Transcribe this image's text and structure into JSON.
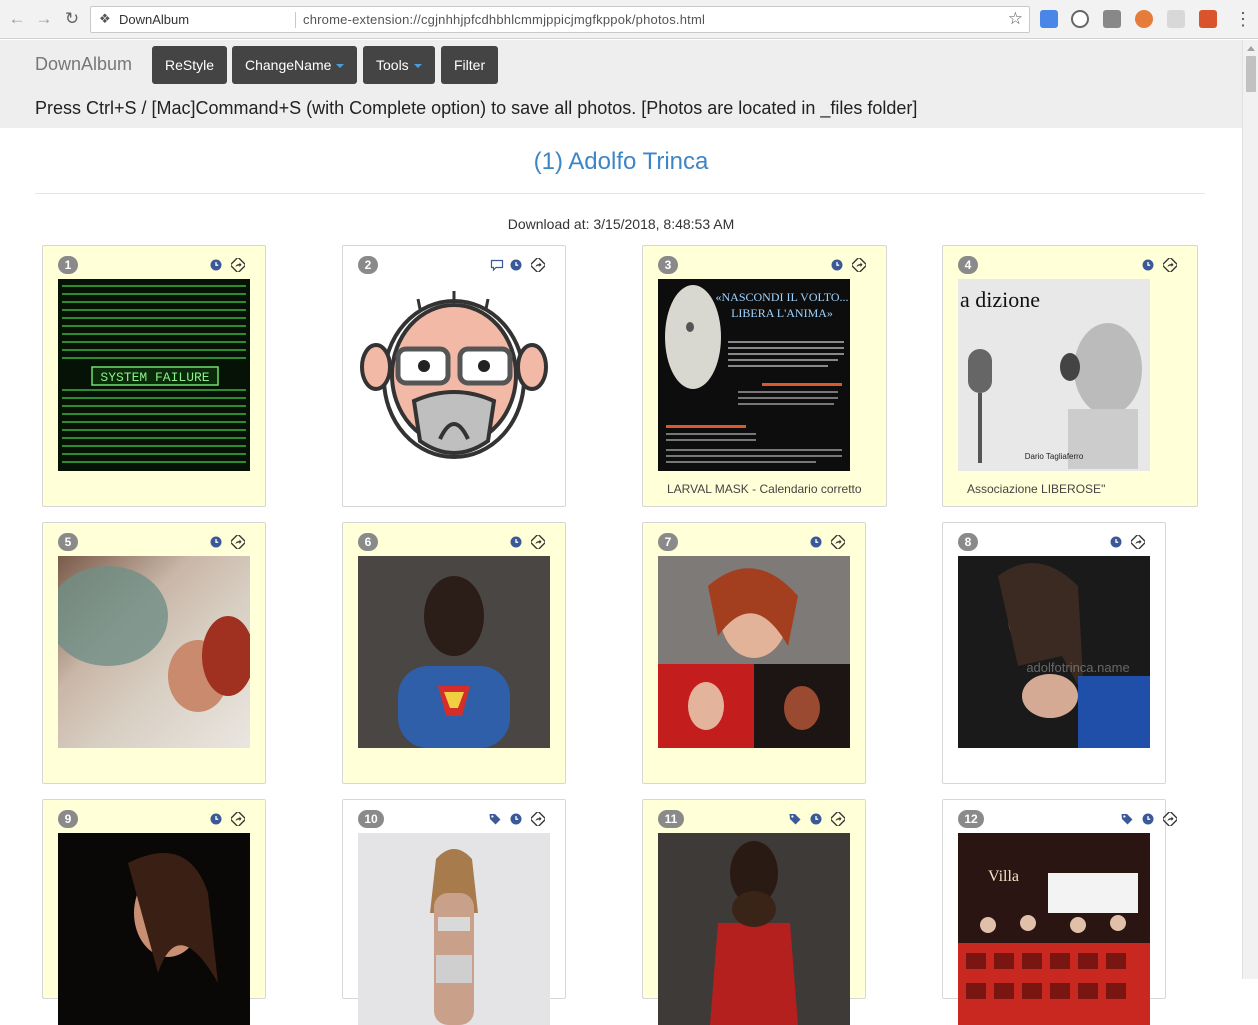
{
  "browser": {
    "tab_title": "DownAlbum",
    "url": "chrome-extension://cgjnhhjpfcdhbhlcmmjppicjmgfkppok/photos.html"
  },
  "header": {
    "brand": "DownAlbum",
    "buttons": {
      "restyle": "ReStyle",
      "changename": "ChangeName",
      "tools": "Tools",
      "filter": "Filter"
    },
    "hint": "Press Ctrl+S / [Mac]Command+S (with Complete option) to save all photos. [Photos are located in _files folder]"
  },
  "album": {
    "title": "(1) Adolfo Trinca",
    "download_label": "Download at: 3/15/2018, 8:48:53 AM"
  },
  "photos": [
    {
      "num": "1",
      "caption": ""
    },
    {
      "num": "2",
      "caption": ""
    },
    {
      "num": "3",
      "caption": "LARVAL MASK - Calendario corretto"
    },
    {
      "num": "4",
      "caption": "Associazione LIBEROSE\""
    },
    {
      "num": "5",
      "caption": ""
    },
    {
      "num": "6",
      "caption": ""
    },
    {
      "num": "7",
      "caption": ""
    },
    {
      "num": "8",
      "caption": ""
    },
    {
      "num": "9",
      "caption": ""
    },
    {
      "num": "10",
      "caption": ""
    },
    {
      "num": "11",
      "caption": ""
    },
    {
      "num": "12",
      "caption": ""
    }
  ],
  "thumb_text": {
    "p1": "SYSTEM FAILURE",
    "p3_title1": "«NASCONDI IL VOLTO...",
    "p3_title2": "LIBERA L'ANIMA»",
    "p4_title": "a dizione",
    "p4_credit": "Dario Tagliaferro",
    "p8_watermark": "adolfotrinca.name",
    "p12_sign": "Villa"
  },
  "colors": {
    "accent": "#3d86c6",
    "toolbar_button": "#444444",
    "card_yellow": "#ffffd8",
    "badge": "#8a8a8a"
  }
}
